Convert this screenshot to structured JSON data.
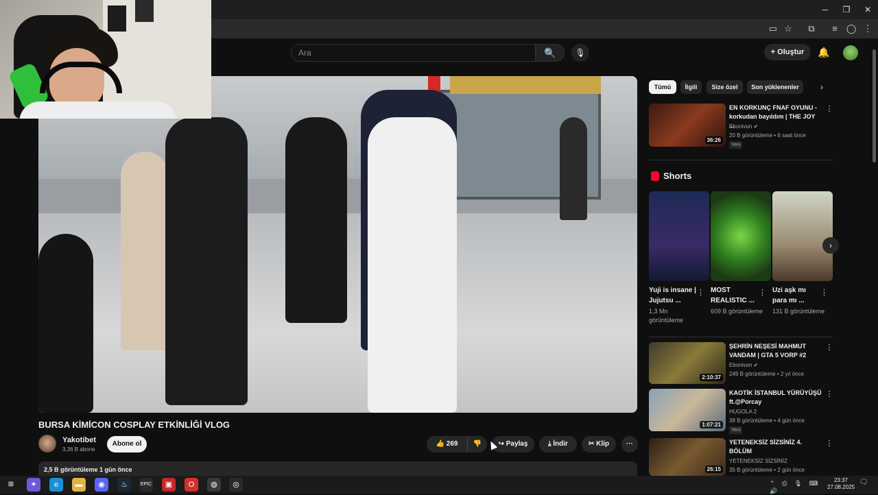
{
  "window": {
    "minimize": "─",
    "maximize": "❐",
    "close": "✕"
  },
  "toolbar_icons": [
    "cast-icon",
    "star-icon",
    "extensions-icon",
    "media-icon",
    "profile-icon",
    "menu-icon"
  ],
  "header": {
    "search_placeholder": "Ara",
    "search_icon": "🔍",
    "mic_icon": "🎙",
    "create_label": "+ Oluştur",
    "bell_icon": "🔔"
  },
  "video": {
    "title": "BURSA KİMİCON COSPLAY ETKİNLİĞİ VLOG",
    "channel": {
      "name": "Yakotibet",
      "subscribers": "3,36 B abone",
      "subscribe_label": "Abone ol"
    },
    "actions": {
      "likes": "👍  269",
      "dislike": "👎",
      "share": "↪  Paylaş",
      "download": "⤓  İndir",
      "clip": "✂  Klip",
      "more": "···"
    },
    "description": {
      "summary": "2,5 B görüntüleme  1 gün önce"
    }
  },
  "sidebar": {
    "chips": [
      "Tümü",
      "İlgili",
      "Size özel",
      "Son yüklenenler"
    ],
    "chip_next": "›",
    "recommendations_top": [
      {
        "title": "EN KORKUNÇ FNAF OYUNU - korkudan bayıldım | THE JOY ...",
        "channel": "Ebonivon ✔",
        "meta": "20 B görüntüleme • 6 saat önce",
        "badge": "Yeni",
        "duration": "36:26",
        "menu": "⋮"
      }
    ],
    "shorts_title": "Shorts",
    "shorts": [
      {
        "title": "Yuji is insane | Jujutsu ...",
        "views": "1,3 Mn görüntüleme",
        "menu": "⋮"
      },
      {
        "title": "MOST REALISTIC ...",
        "views": "609 B görüntüleme",
        "menu": "⋮"
      },
      {
        "title": "Uzi aşk mı para mı ...",
        "views": "131 B görüntüleme",
        "menu": "⋮"
      }
    ],
    "shorts_next": "›",
    "recommendations_bottom": [
      {
        "title": "ŞEHRİN NEŞESİ MAHMUT VANDAM | GTA 5 VORP #2",
        "channel": "Ebonivon ✔",
        "meta": "249 B görüntüleme • 2 yıl önce",
        "duration": "2:10:37",
        "menu": "⋮"
      },
      {
        "title": "KAOTİK İSTANBUL YÜRÜYÜŞÜ ft.@Porcay",
        "channel": "HUGOLA 2",
        "meta": "38 B görüntüleme • 4 gün önce",
        "badge": "Yeni",
        "duration": "1:07:21",
        "menu": "⋮"
      },
      {
        "title": "YETENEKSİZ SİZSİNİZ 4. BÖLÜM",
        "channel": "YETENEKSİZ SİZSİNİZ",
        "meta": "35 B görüntüleme • 2 gün önce",
        "duration": "26:15",
        "menu": "⋮"
      }
    ]
  },
  "taskbar": {
    "start_icon": "⊞",
    "apps": [
      {
        "name": "copilot",
        "glyph": "✦",
        "color": "#6b5bd6"
      },
      {
        "name": "edge",
        "glyph": "e",
        "color": "#1a8fd6"
      },
      {
        "name": "file-explorer",
        "glyph": "▬",
        "color": "#e3b341"
      },
      {
        "name": "discord",
        "glyph": "◉",
        "color": "#5865f2"
      },
      {
        "name": "steam",
        "glyph": "♨",
        "color": "#1b2838"
      },
      {
        "name": "epic-games",
        "glyph": "EPIC",
        "color": "#2a2a2a"
      },
      {
        "name": "app-red",
        "glyph": "▣",
        "color": "#c62828"
      },
      {
        "name": "opera",
        "glyph": "O",
        "color": "#d32f2f"
      },
      {
        "name": "chrome",
        "glyph": "◍",
        "color": "#3a3a3a"
      },
      {
        "name": "obs",
        "glyph": "◎",
        "color": "#2a2a2a"
      }
    ],
    "tray_icons": "⌃ ⎙ 🎙 ⌨ 🔊",
    "time": "23:37",
    "date": "27.08.2025",
    "notification_icon": "🗨"
  },
  "colors": {
    "accent": "#ff0033",
    "background": "#0f0f0f",
    "chip_active": "#f1f1f1"
  }
}
